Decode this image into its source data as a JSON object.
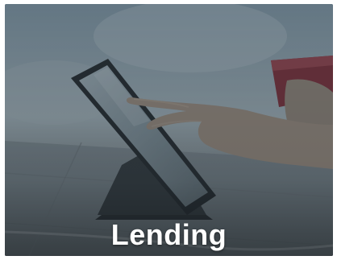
{
  "tile": {
    "caption": "Lending"
  },
  "photo": {
    "subject": "hand-tapping-tablet-holding-card"
  },
  "colors": {
    "caption_text": "#ffffff",
    "overlay": "#3a444b"
  }
}
